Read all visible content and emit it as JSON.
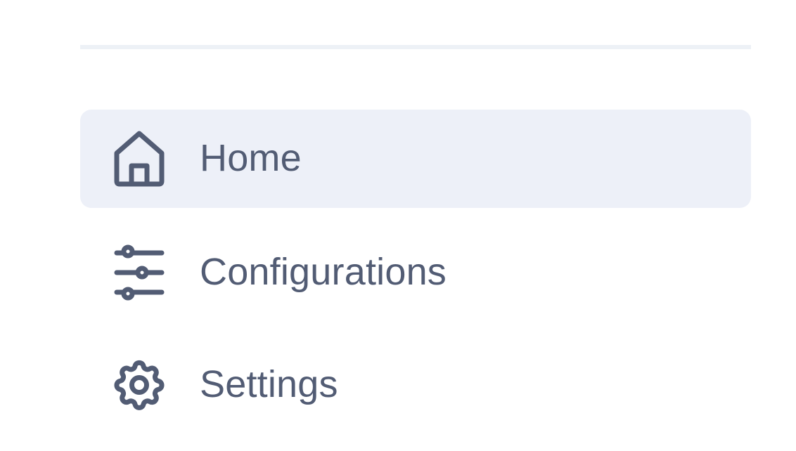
{
  "nav": {
    "items": [
      {
        "label": "Home",
        "icon": "home-icon",
        "active": true
      },
      {
        "label": "Configurations",
        "icon": "sliders-icon",
        "active": false
      },
      {
        "label": "Settings",
        "icon": "gear-icon",
        "active": false
      }
    ]
  },
  "colors": {
    "text": "#525c74",
    "icon": "#525c74",
    "active_background": "#edf0f8",
    "divider": "#edf1f6"
  }
}
